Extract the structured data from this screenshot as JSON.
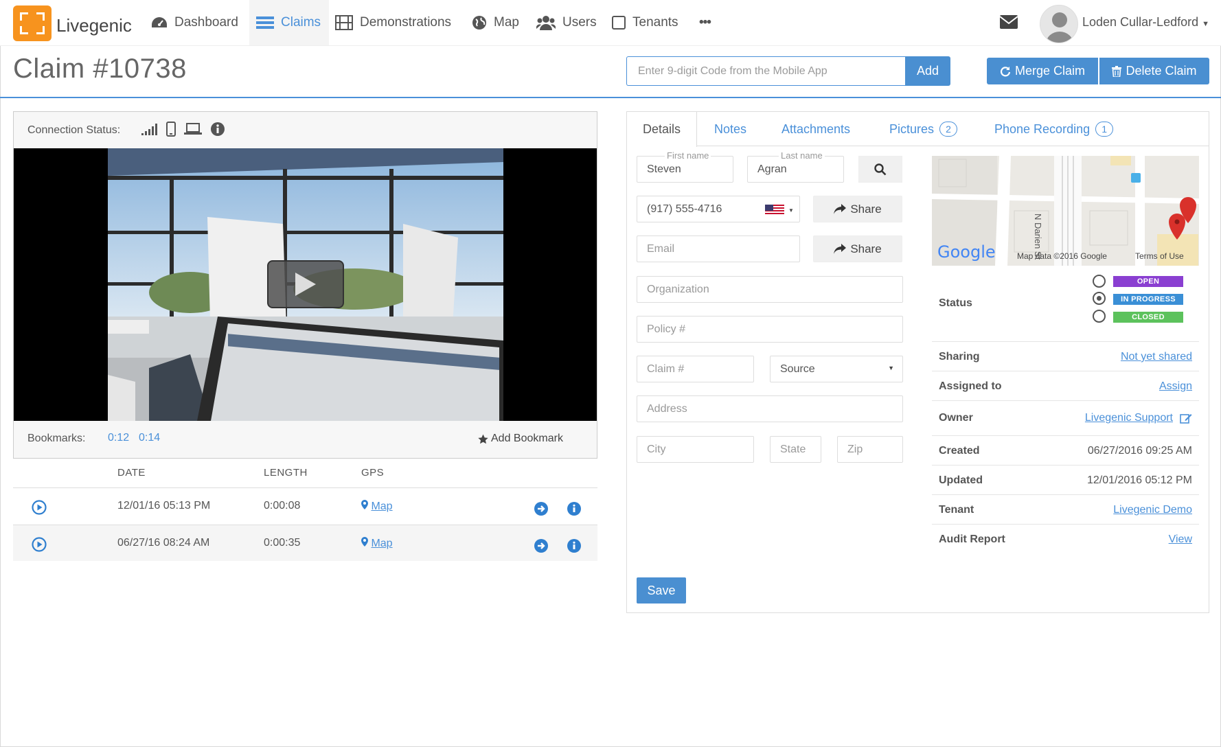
{
  "nav": {
    "brand": "Livegenic",
    "items": [
      {
        "label": "Dashboard"
      },
      {
        "label": "Claims"
      },
      {
        "label": "Demonstrations"
      },
      {
        "label": "Map"
      },
      {
        "label": "Users"
      },
      {
        "label": "Tenants"
      }
    ],
    "more": "•••",
    "user": "Loden Cullar-Ledford"
  },
  "header": {
    "title": "Claim #10738",
    "code_placeholder": "Enter 9-digit Code from the Mobile App",
    "add_label": "Add",
    "merge_label": "Merge Claim",
    "delete_label": "Delete Claim"
  },
  "video": {
    "connection_label": "Connection Status:",
    "bookmarks_label": "Bookmarks:",
    "bookmarks": [
      "0:12",
      "0:14"
    ],
    "add_bookmark": "Add Bookmark"
  },
  "recordings": {
    "columns": [
      "DATE",
      "LENGTH",
      "GPS"
    ],
    "rows": [
      {
        "date": "12/01/16 05:13 PM",
        "length": "0:00:08",
        "gps": "Map"
      },
      {
        "date": "06/27/16 08:24 AM",
        "length": "0:00:35",
        "gps": "Map"
      }
    ]
  },
  "tabs": [
    {
      "label": "Details"
    },
    {
      "label": "Notes"
    },
    {
      "label": "Attachments"
    },
    {
      "label": "Pictures",
      "badge": "2"
    },
    {
      "label": "Phone Recording",
      "badge": "1"
    }
  ],
  "form": {
    "first_name_label": "First name",
    "first_name": "Steven",
    "last_name_label": "Last name",
    "last_name": "Agran",
    "phone": "(917) 555-4716",
    "share_label": "Share",
    "email_placeholder": "Email",
    "organization_placeholder": "Organization",
    "policy_placeholder": "Policy #",
    "claim_placeholder": "Claim #",
    "source_placeholder": "Source",
    "address_placeholder": "Address",
    "city_placeholder": "City",
    "state_placeholder": "State",
    "zip_placeholder": "Zip",
    "save_label": "Save"
  },
  "map": {
    "street": "N Darien St",
    "logo": "Google",
    "attribution": "Map data ©2016 Google",
    "terms": "Terms of Use"
  },
  "status": {
    "label": "Status",
    "options": [
      {
        "label": "OPEN",
        "color": "#8a3fd1",
        "selected": false
      },
      {
        "label": "IN PROGRESS",
        "color": "#3a8fd6",
        "selected": true
      },
      {
        "label": "CLOSED",
        "color": "#5cc25c",
        "selected": false
      }
    ]
  },
  "info": [
    {
      "key": "Sharing",
      "value": "Not yet shared",
      "link": true
    },
    {
      "key": "Assigned to",
      "value": "Assign",
      "link": true
    },
    {
      "key": "Owner",
      "value": "Livegenic Support",
      "link": true
    },
    {
      "key": "Created",
      "value": "06/27/2016 09:25 AM",
      "link": false
    },
    {
      "key": "Updated",
      "value": "12/01/2016 05:12 PM",
      "link": false
    },
    {
      "key": "Tenant",
      "value": "Livegenic Demo",
      "link": true
    },
    {
      "key": "Audit Report",
      "value": "View",
      "link": true
    }
  ],
  "colors": {
    "accent": "#4a90d9",
    "brand": "#f7931e"
  }
}
